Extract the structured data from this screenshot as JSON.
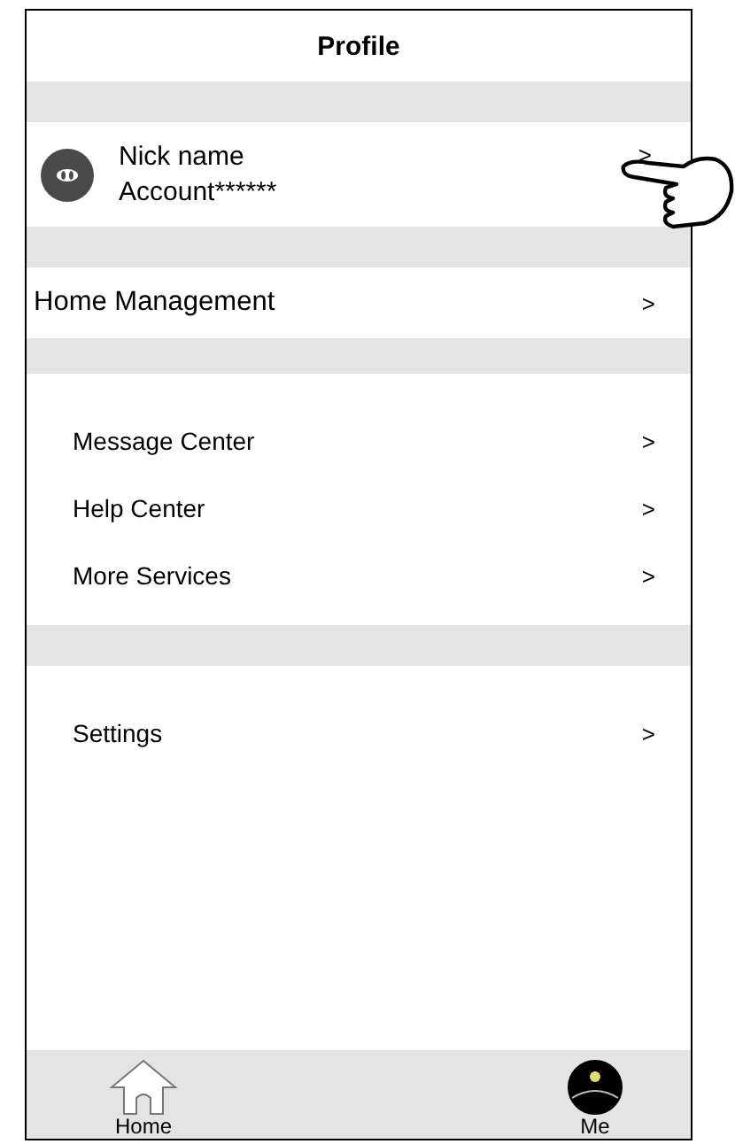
{
  "header": {
    "title": "Profile"
  },
  "profile": {
    "nickname": "Nick name",
    "account": "Account******",
    "chevron": ">"
  },
  "groups": [
    {
      "kind": "plain",
      "items": [
        {
          "label": "Home Management",
          "chevron": ">"
        }
      ]
    },
    {
      "kind": "indented",
      "items": [
        {
          "label": "Message Center",
          "chevron": ">"
        },
        {
          "label": "Help Center",
          "chevron": ">"
        },
        {
          "label": "More Services",
          "chevron": ">"
        }
      ]
    },
    {
      "kind": "indented",
      "items": [
        {
          "label": "Settings",
          "chevron": ">"
        }
      ]
    }
  ],
  "tab_bar": [
    {
      "label": "Home",
      "kind": "home",
      "selected": false
    },
    {
      "label": "Me",
      "kind": "me",
      "selected": true
    }
  ]
}
